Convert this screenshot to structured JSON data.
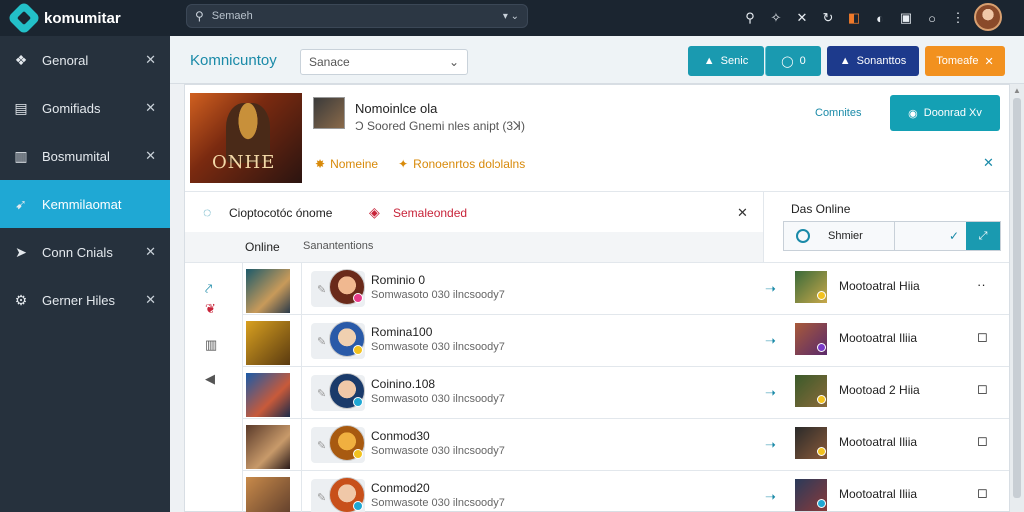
{
  "app": {
    "brand": "komumitar"
  },
  "search": {
    "value": "Semaeh"
  },
  "sidebar": {
    "items": [
      {
        "label": "Genoral",
        "icon": "gamepad-icon"
      },
      {
        "label": "Gomifiads",
        "icon": "folder-icon"
      },
      {
        "label": "Bosmumital",
        "icon": "building-icon"
      },
      {
        "label": "Kemmilaomat",
        "icon": "megaphone-icon"
      },
      {
        "label": "Conn Cnials",
        "icon": "play-icon"
      },
      {
        "label": "Gerner Hiles",
        "icon": "gear-icon"
      }
    ],
    "active_index": 3
  },
  "header": {
    "title": "Komnicuntoy",
    "select": "Sanace",
    "btn1": "Senic",
    "btn2": "0",
    "btn3": "Sonanttos",
    "btn4": "Tomeafe"
  },
  "game": {
    "banner_text": "ONHE",
    "title": "Nomoinlce ola",
    "subtitle": "Ɔ Soored Gnemi nles anipt (3ꓘ)",
    "link": "Comnites",
    "primary_btn": "Doonrad Xv",
    "tag1": "Nomeine",
    "tag2": "Ronoenrtos dolɔlalns"
  },
  "chat": {
    "left_text": "Cioptocotóc ónome",
    "right_text": "Semaleonded"
  },
  "tabs": {
    "t1": "Online",
    "t2": "Sanantentions"
  },
  "online_panel": {
    "title": "Das Online",
    "label": "Shmier"
  },
  "rows": [
    {
      "name": "Rominio 0",
      "meta": "Somwasoto 030 ilncsoody7",
      "right": "Mootoatral Hiia"
    },
    {
      "name": "Romina100",
      "meta": "Somwasote 030 ilncsoody7",
      "right": "Mootoatral Iliia"
    },
    {
      "name": "Coinino.108",
      "meta": "Somwasoto 030 ilncsoody7",
      "right": "Mootoad 2 Hiia"
    },
    {
      "name": "Conmod30",
      "meta": "Somwasote 030 ilncsoody7",
      "right": "Mootoatral Iliia"
    },
    {
      "name": "Conmod20",
      "meta": "Somwasote 030 ilncsoody7",
      "right": "Mootoatral Iliia"
    }
  ],
  "colors": {
    "accent": "#1fa8d4",
    "topbar": "#1b2530",
    "sidebar": "#26313d",
    "navy": "#1d3a8c",
    "orange": "#f2911f",
    "teal": "#1a9ab0"
  }
}
